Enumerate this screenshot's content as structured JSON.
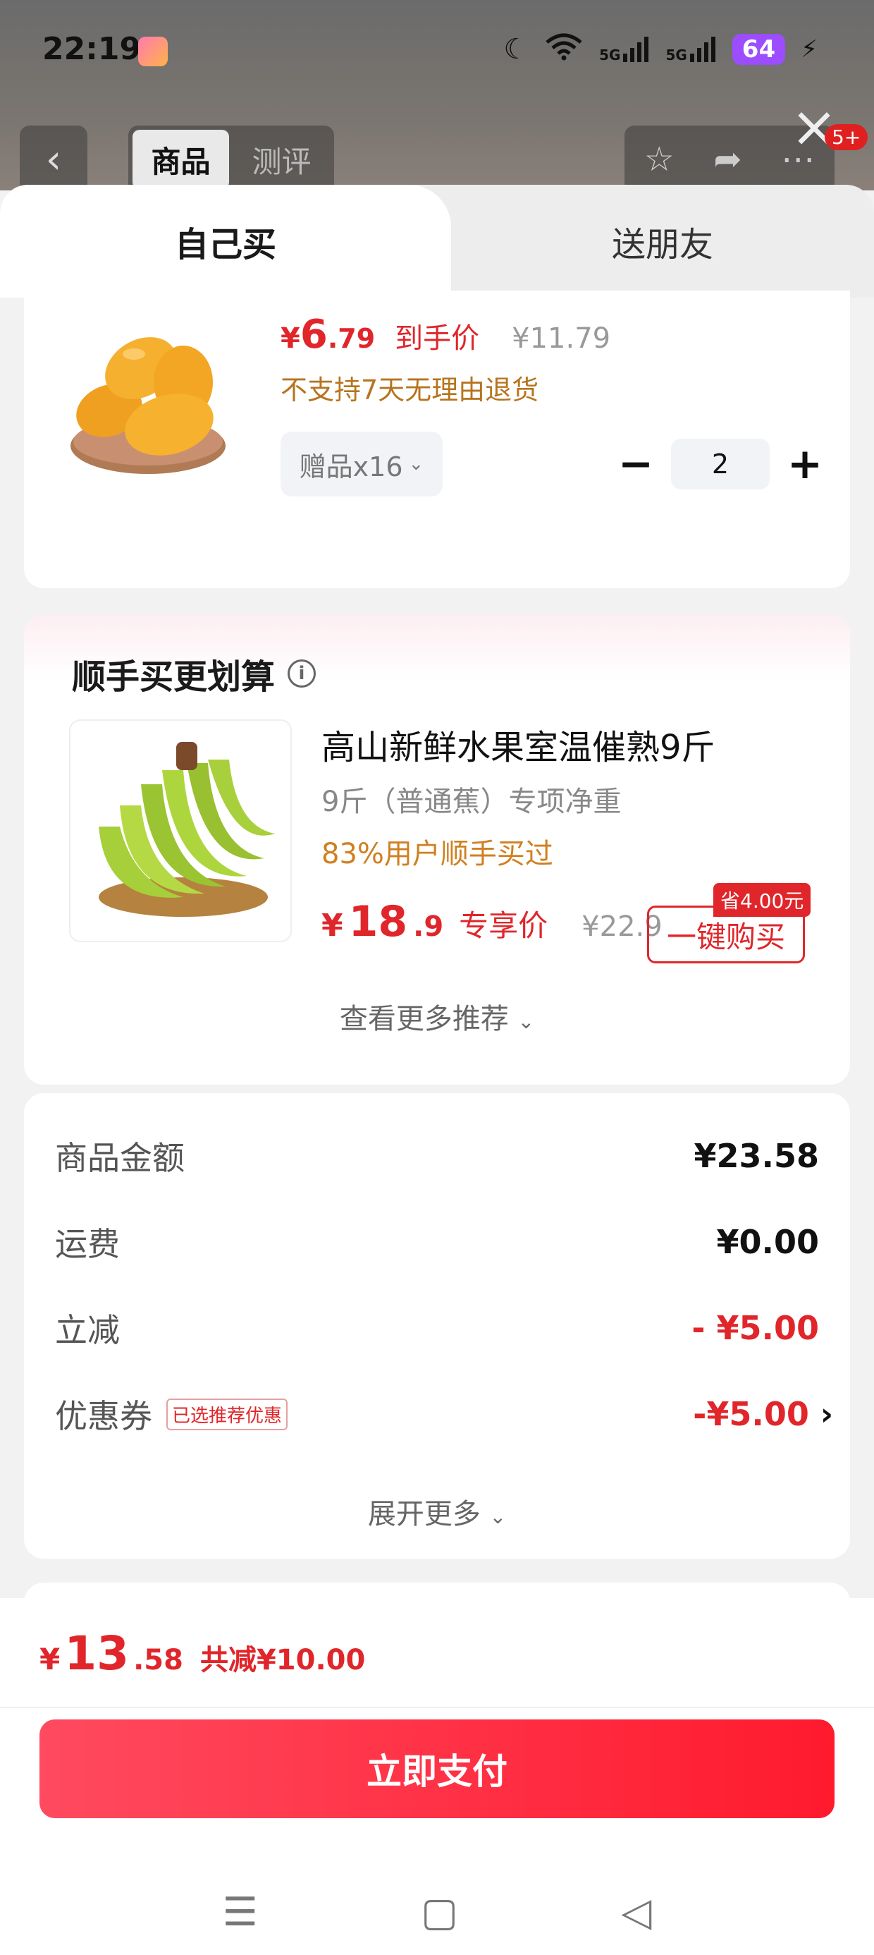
{
  "status_bar": {
    "time": "22:19",
    "signal1": "5G",
    "signal2": "5G",
    "battery": "64"
  },
  "top_nav": {
    "tabs": [
      "商品",
      "测评"
    ],
    "badge": "5+"
  },
  "sheet_tabs": {
    "self": "自己买",
    "friend": "送朋友"
  },
  "product": {
    "price_symbol": "¥",
    "price_int": "6",
    "price_dec": ".79",
    "price_label": "到手价",
    "original_price": "¥11.79",
    "return_policy": "不支持7天无理由退货",
    "gift": "赠品x16",
    "quantity": "2"
  },
  "recommend": {
    "title": "顺手买更划算",
    "item_name": "高山新鲜水果室温催熟9斤",
    "spec": "9斤（普通蕉）专项净重",
    "buyers": "83%用户顺手买过",
    "price_symbol": "¥",
    "price_int": "18",
    "price_dec": ".9",
    "price_tag": "专享价",
    "original_price": "¥22.9",
    "save_badge": "省4.00元",
    "buy_button": "一键购买",
    "more": "查看更多推荐"
  },
  "summary": {
    "rows": [
      {
        "label": "商品金额",
        "value": "¥23.58"
      },
      {
        "label": "运费",
        "value": "¥0.00"
      },
      {
        "label": "立减",
        "value": "- ¥5.00"
      },
      {
        "label": "优惠券",
        "tag": "已选推荐优惠",
        "value": "-¥5.00"
      }
    ],
    "expand": "展开更多"
  },
  "footer": {
    "total_symbol": "¥",
    "total_int": "13",
    "total_dec": ".58",
    "total_saved": "共减¥10.00",
    "pay_button": "立即支付"
  },
  "colors": {
    "accent": "#e0262a",
    "pay_gradient_start": "#ff4a5f",
    "pay_gradient_end": "#ff1a2e"
  }
}
